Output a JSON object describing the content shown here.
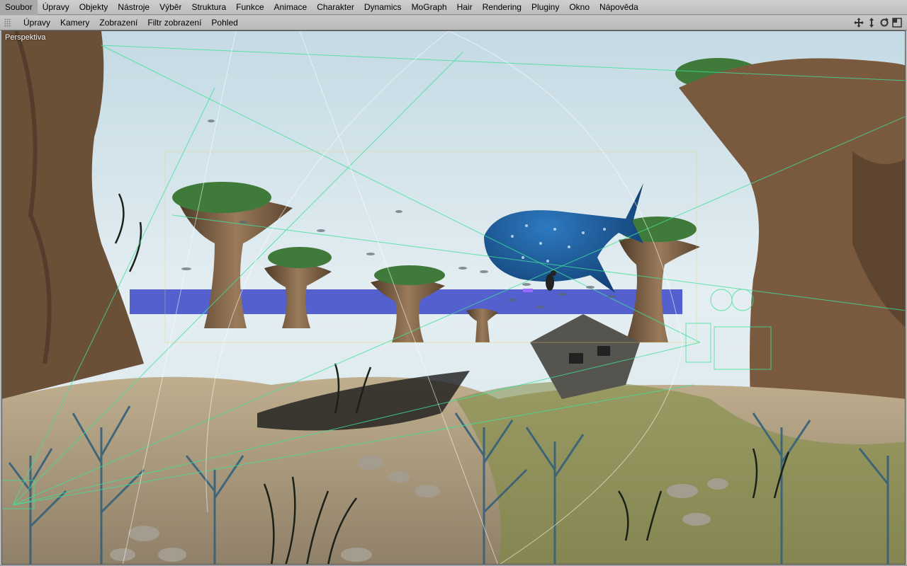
{
  "menu": [
    "Soubor",
    "Úpravy",
    "Objekty",
    "Nástroje",
    "Výběr",
    "Struktura",
    "Funkce",
    "Animace",
    "Charakter",
    "Dynamics",
    "MoGraph",
    "Hair",
    "Rendering",
    "Pluginy",
    "Okno",
    "Nápověda"
  ],
  "viewport_menu": [
    "Úpravy",
    "Kamery",
    "Zobrazení",
    "Filtr zobrazení",
    "Pohled"
  ],
  "viewport_label": "Perspektiva",
  "nav_icons": [
    "move-view-icon",
    "dolly-view-icon",
    "rotate-view-icon",
    "toggle-view-icon"
  ],
  "colors": {
    "sky": "#dfeaef",
    "sea": "#3a46c8",
    "rock": "#7a5f44",
    "sand": "#c9b79a",
    "coral": "#3f6b86",
    "shark": "#1e5fa0",
    "wire": "#3fe09a"
  }
}
